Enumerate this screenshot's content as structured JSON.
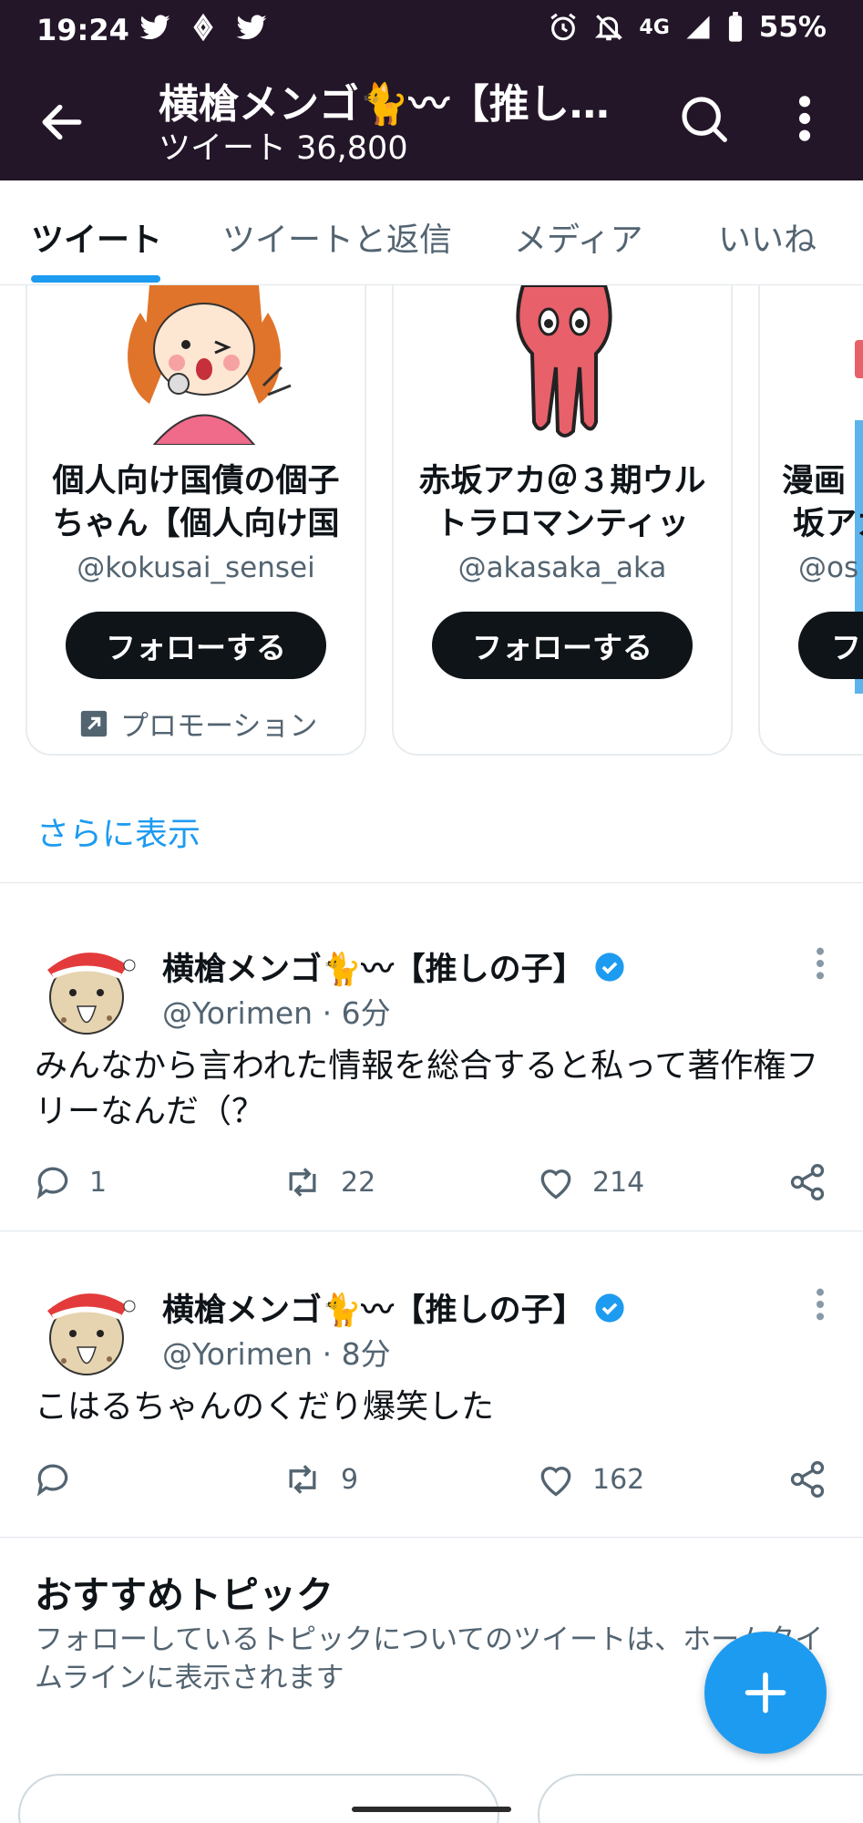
{
  "status_bar": {
    "time": "19:24",
    "network": "4G",
    "battery": "55%"
  },
  "header": {
    "title": "横槍メンゴ🐈〰【推し…",
    "subtitle": "ツイート 36,800"
  },
  "tabs": [
    "ツイート",
    "ツイートと返信",
    "メディア",
    "いいね"
  ],
  "suggestions": [
    {
      "name_line1": "個人向け国債の個子",
      "name_line2": "ちゃん【個人向け国",
      "handle": "@kokusai_sensei",
      "follow_label": "フォローする",
      "promo_label": "プロモーション"
    },
    {
      "name_line1": "赤坂アカ＠３期ウル",
      "name_line2": "トラロマンティッ",
      "handle": "@akasaka_aka",
      "follow_label": "フォローする"
    },
    {
      "name_line1": "漫画",
      "name_line2": "坂アカ",
      "handle": "@os",
      "follow_label": "フ"
    }
  ],
  "show_more": "さらに表示",
  "tweets": [
    {
      "name": "横槍メンゴ🐈〰【推しの子】",
      "handle": "@Yorimen",
      "time": "6分",
      "text": "みんなから言われた情報を総合すると私って著作権フリーなんだ（？",
      "replies": "1",
      "retweets": "22",
      "likes": "214"
    },
    {
      "name": "横槍メンゴ🐈〰【推しの子】",
      "handle": "@Yorimen",
      "time": "8分",
      "text": "こはるちゃんのくだり爆笑した",
      "replies": "",
      "retweets": "9",
      "likes": "162"
    }
  ],
  "topics": {
    "title": "おすすめトピック",
    "description": "フォローしているトピックについてのツイートは、ホームタイムラインに表示されます"
  },
  "colors": {
    "header_bg": "#231629",
    "accent": "#1d9bf0",
    "verified": "#1d9bf0"
  }
}
